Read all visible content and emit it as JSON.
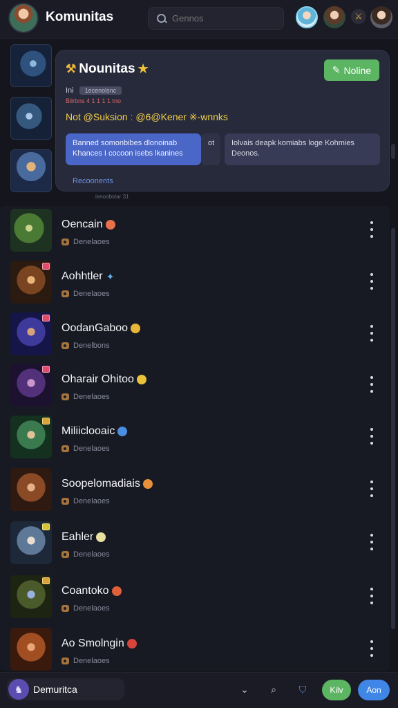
{
  "header": {
    "app_title": "Komunitas",
    "search_placeholder": "Gennos"
  },
  "card": {
    "title": "Nounitas",
    "join_label": "Noline",
    "meta_prefix": "Ini",
    "meta_pill": "1ecenolsnc",
    "meta_line2": "Bilrbns 4 1 1 1 1 tno",
    "tagline": "Not @Suksion ː @6@Kener ※-wnnks",
    "feature1": "Banned somonbibes dlonoinab Khances I cocoon isebs lkanines",
    "feature1_extra": "ot",
    "feature2": "Iolvais deapk komiabs loge Kohmies Deonos.",
    "link": "Recoonents",
    "under_text": "ienoobstar 31"
  },
  "list": [
    {
      "name": "Oencain",
      "emoji": "orange",
      "sub": "Denelaoes"
    },
    {
      "name": "Aohhtler",
      "emoji": "blue-spark",
      "sub": "Denelaoes"
    },
    {
      "name": "OodanGaboo",
      "emoji": "yellow",
      "sub": "Denelbons"
    },
    {
      "name": "Oharair Ohitoo",
      "emoji": "yellow",
      "sub": "Denelaoes"
    },
    {
      "name": "Miliiclooaic",
      "emoji": "blue",
      "sub": "Denelaoes"
    },
    {
      "name": "Soopelomadiais",
      "emoji": "orange",
      "sub": "Denelaoes"
    },
    {
      "name": "Eahler",
      "emoji": "pale",
      "sub": "Denelaoes"
    },
    {
      "name": "Coantoko",
      "emoji": "red-orange",
      "sub": "Denelaoes"
    },
    {
      "name": "Ao Smolngin",
      "emoji": "red",
      "sub": "Denelaoes"
    }
  ],
  "bottom": {
    "user_label": "Demuritca",
    "green_label": "Kilv",
    "blue_label": "Aon"
  },
  "colors": {
    "accent_green": "#5cb562",
    "accent_blue": "#3f86e6",
    "tagline_yellow": "#f2cf4a"
  }
}
